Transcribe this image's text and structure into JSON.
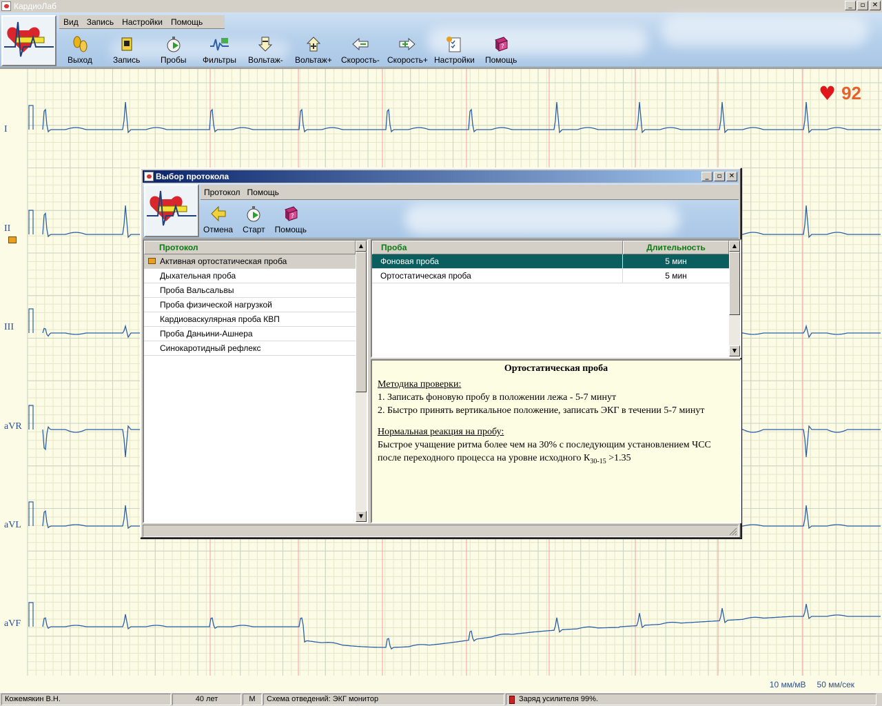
{
  "window": {
    "title": "КардиоЛаб",
    "controls": [
      "_",
      "▫",
      "✕"
    ]
  },
  "menu": [
    "Вид",
    "Запись",
    "Настройки",
    "Помощь"
  ],
  "toolbar": [
    {
      "label": "Выход",
      "icon": "footsteps-icon"
    },
    {
      "label": "Запись",
      "icon": "record-icon"
    },
    {
      "label": "Пробы",
      "icon": "stopwatch-icon"
    },
    {
      "label": "Фильтры",
      "icon": "filter-icon"
    },
    {
      "label": "Вольтаж-",
      "icon": "voltage-down-icon"
    },
    {
      "label": "Вольтаж+",
      "icon": "voltage-up-icon"
    },
    {
      "label": "Скорость-",
      "icon": "speed-down-icon"
    },
    {
      "label": "Скорость+",
      "icon": "speed-up-icon"
    },
    {
      "label": "Настройки",
      "icon": "settings-checklist-icon"
    },
    {
      "label": "Помощь",
      "icon": "help-book-icon"
    }
  ],
  "heart_rate": "92",
  "leads": [
    "I",
    "II",
    "III",
    "aVR",
    "aVL",
    "aVF"
  ],
  "scale": {
    "amplitude": "10 мм/мВ",
    "speed": "50 мм/сек"
  },
  "status": {
    "patient": "Кожемякин В.Н.",
    "age": "40 лет",
    "sex": "М",
    "scheme": "Схема отведений: ЭКГ монитор",
    "battery": "Заряд усилителя 99%."
  },
  "dialog": {
    "title": "Выбор протокола",
    "menu": [
      "Протокол",
      "Помощь"
    ],
    "buttons": [
      {
        "label": "Отмена",
        "icon": "back-arrow-icon"
      },
      {
        "label": "Старт",
        "icon": "stopwatch-start-icon"
      },
      {
        "label": "Помощь",
        "icon": "help-book-icon"
      }
    ],
    "protocols_header": "Протокол",
    "protocols": [
      "Активная ортостатическая проба",
      "Дыхательная проба",
      "Проба Вальсальвы",
      "Проба физической нагрузкой",
      "Кардиоваскулярная проба КВП",
      "Проба Даньини-Ашнера",
      "Синокаротидный рефлекс"
    ],
    "selected_protocol": 0,
    "tests_header": {
      "name": "Проба",
      "duration": "Длительность"
    },
    "tests": [
      {
        "name": "Фоновая проба",
        "duration": "5 мин"
      },
      {
        "name": "Ортостатическая проба",
        "duration": "5 мин"
      }
    ],
    "selected_test": 0,
    "description": {
      "title": "Ортостатическая проба",
      "method_heading": "Методика проверки:",
      "method_1": "1. Записать фоновую пробу в положении лежа - 5-7 минут",
      "method_2": "2. Быстро принять вертикальное положение, записать ЭКГ в течении 5-7 минут",
      "normal_heading": "Нормальная реакция на пробу:",
      "normal_text_1": "Быстрое учащение ритма более чем на 30% с последующим установлением ЧСС после переходного процесса на уровне исходного К",
      "normal_sub": "30-15",
      "normal_text_2": " >1.35"
    }
  },
  "colors": {
    "ecg_trace": "#2b5fa8",
    "grid_minor": "#e6e6c8",
    "grid_major": "#c9d3c0",
    "marker_red": "#f0a0a0",
    "selected_row": "#0a5f5e",
    "header_text": "#0b7a11",
    "hr_value": "#e8612c"
  }
}
